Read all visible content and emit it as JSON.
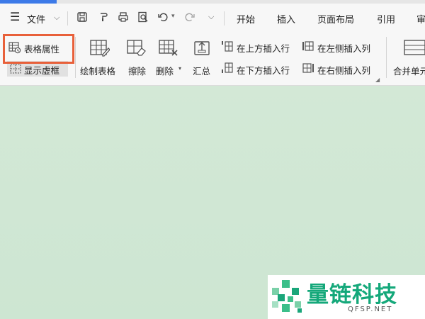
{
  "menubar": {
    "file_menu": "文件",
    "tabs": [
      {
        "label": "开始"
      },
      {
        "label": "插入"
      },
      {
        "label": "页面布局"
      },
      {
        "label": "引用"
      },
      {
        "label": "审"
      }
    ]
  },
  "ribbon": {
    "table_properties": "表格属性",
    "show_gridlines": "显示虚框",
    "draw_table": "绘制表格",
    "erase": "擦除",
    "delete": "删除",
    "summary": "汇总",
    "insert_row_above": "在上方插入行",
    "insert_row_below": "在下方插入行",
    "insert_col_left": "在左侧插入列",
    "insert_col_right": "在右侧插入列",
    "merge_cells": "合并单元"
  },
  "watermark": {
    "title": "量链科技",
    "subtitle": "QFSP.NET"
  },
  "colors": {
    "accent": "#3d7ae8",
    "highlight": "#e8603a",
    "brand": "#14a87a",
    "document_bg": "#d3e8d6"
  }
}
